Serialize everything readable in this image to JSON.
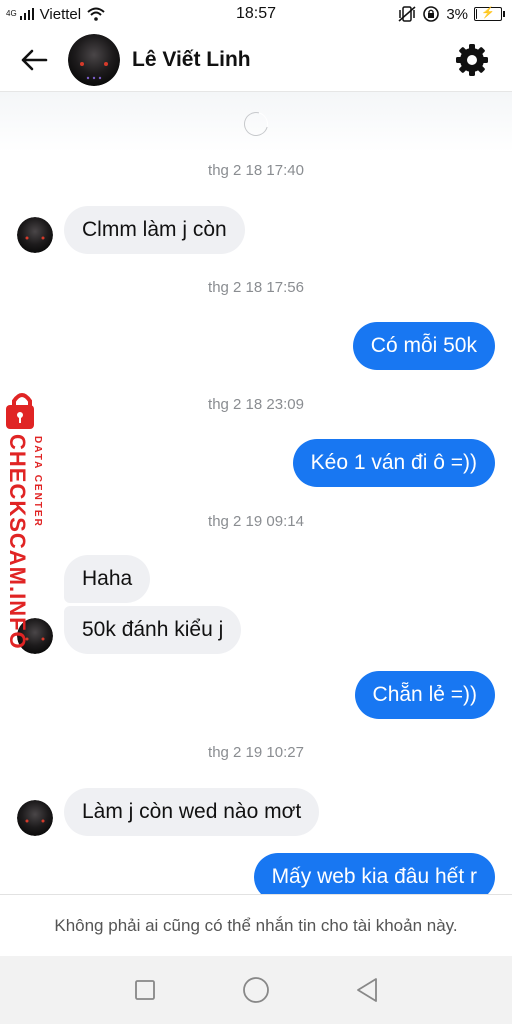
{
  "status_bar": {
    "network_type": "4G",
    "carrier": "Viettel",
    "time": "18:57",
    "battery": "3%",
    "battery_level": 0.03,
    "icons": [
      "signal-icon",
      "wifi-icon",
      "vibrate-icon",
      "rotation-lock-icon",
      "battery-charging-icon"
    ]
  },
  "header": {
    "contact_name": "Lê Viết Linh",
    "back_icon": "arrow-left-icon",
    "settings_icon": "gear-icon"
  },
  "conversation": {
    "timestamps": [
      "thg 2 18 17:40",
      "thg 2 18 17:56",
      "thg 2 18 23:09",
      "thg 2 19 09:14",
      "thg 2 19 10:27"
    ],
    "messages": [
      {
        "direction": "in",
        "text": "Clmm làm j còn"
      },
      {
        "direction": "out",
        "text": "Có mỗi 50k"
      },
      {
        "direction": "out",
        "text": "Kéo 1 ván đi ô =))"
      },
      {
        "direction": "in",
        "text": "Haha"
      },
      {
        "direction": "in",
        "text": "50k đánh kiểu j"
      },
      {
        "direction": "out",
        "text": "Chẵn lẻ =))"
      },
      {
        "direction": "in",
        "text": "Làm j còn wed nào mơt"
      },
      {
        "direction": "out",
        "text": "Mấy web kia đâu hết r"
      }
    ],
    "colors": {
      "outgoing": "#1877f2",
      "incoming": "#eff0f3"
    }
  },
  "watermark": {
    "site": "CHECKSCAM.INFO",
    "label": "DATA CENTER",
    "color": "#e02424"
  },
  "notice": "Không phải ai cũng có thể nhắn tin cho tài khoản này.",
  "nav_bar": {
    "icons": [
      "recent-apps-icon",
      "home-icon",
      "back-triangle-icon"
    ]
  }
}
